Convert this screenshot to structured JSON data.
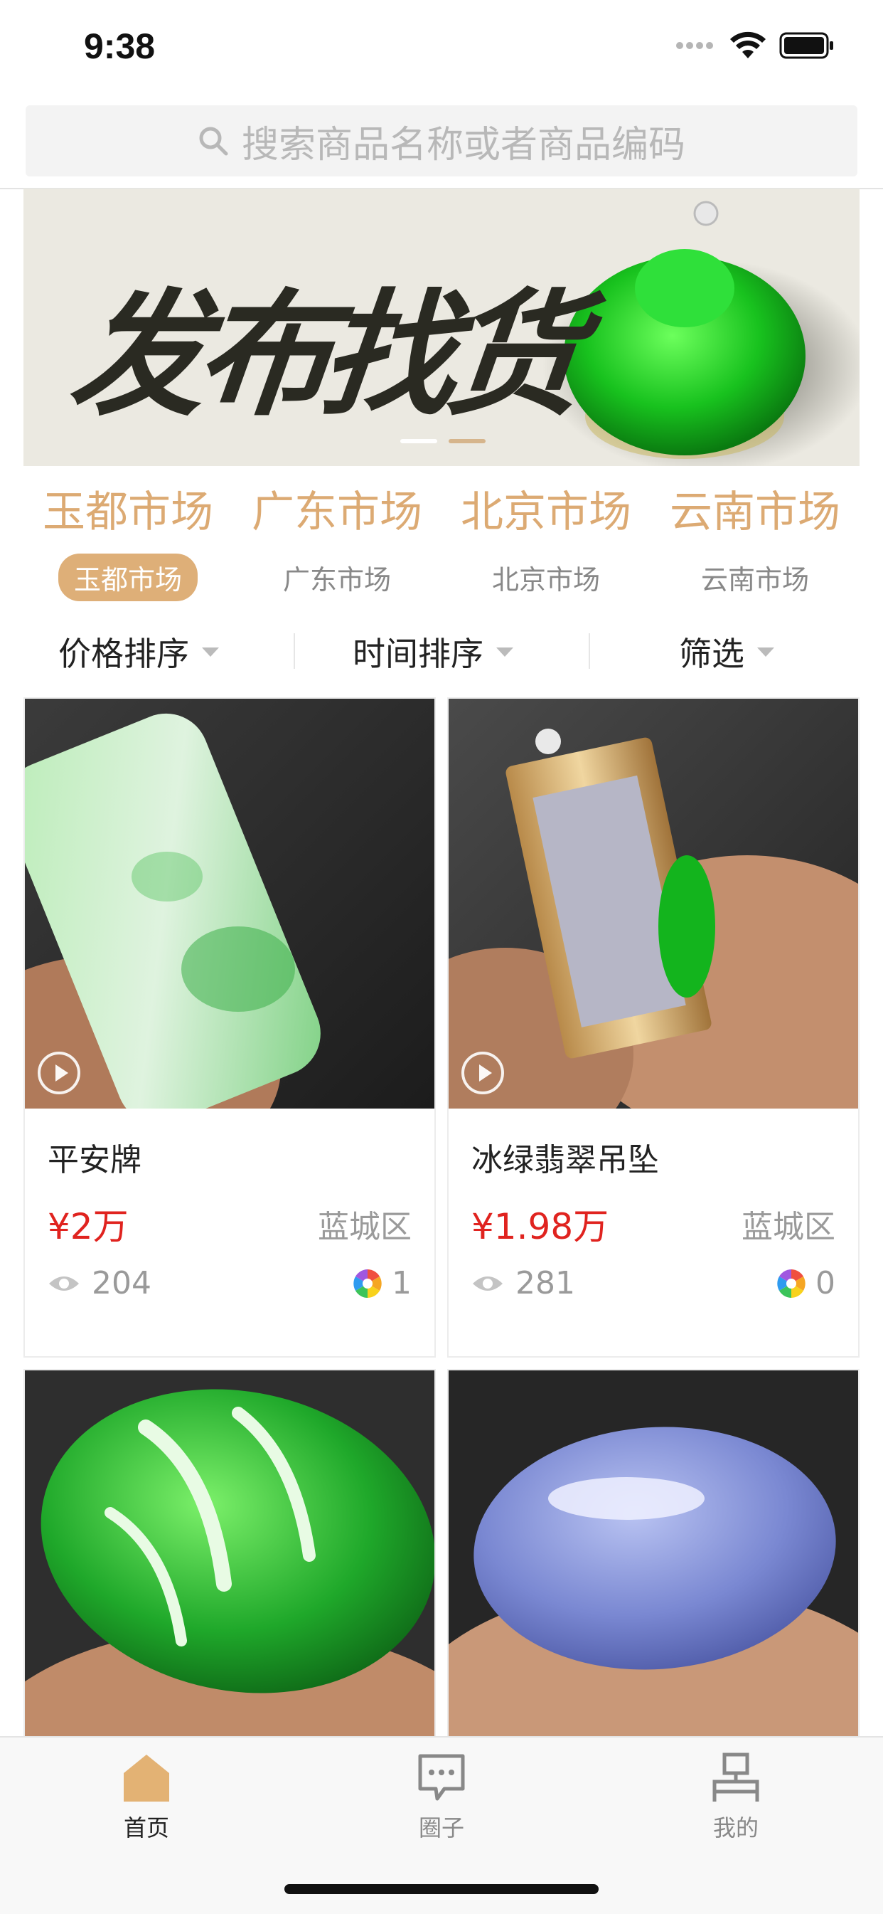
{
  "status": {
    "time": "9:38"
  },
  "search": {
    "placeholder": "搜索商品名称或者商品编码"
  },
  "banner": {
    "title": "发布找货",
    "slide_index": 2,
    "slide_count": 2
  },
  "markets": {
    "titles": [
      "玉都市场",
      "广东市场",
      "北京市场",
      "云南市场"
    ],
    "tabs": [
      {
        "label": "玉都市场",
        "active": true
      },
      {
        "label": "广东市场",
        "active": false
      },
      {
        "label": "北京市场",
        "active": false
      },
      {
        "label": "云南市场",
        "active": false
      }
    ]
  },
  "sort": {
    "price": "价格排序",
    "time": "时间排序",
    "filter": "筛选"
  },
  "products": [
    {
      "name": "平安牌",
      "price": "¥2万",
      "location": "蓝城区",
      "views": "204",
      "circle": "1"
    },
    {
      "name": "冰绿翡翠吊坠",
      "price": "¥1.98万",
      "location": "蓝城区",
      "views": "281",
      "circle": "0"
    },
    {
      "name": "",
      "price": "",
      "location": "",
      "views": "",
      "circle": ""
    },
    {
      "name": "",
      "price": "",
      "location": "",
      "views": "",
      "circle": ""
    }
  ],
  "tabbar": {
    "home": "首页",
    "circle": "圈子",
    "mine": "我的",
    "active_color": "#dcaa73",
    "inactive_color": "#888888"
  },
  "colors": {
    "accent": "#deaf78",
    "price": "#e0231f"
  }
}
